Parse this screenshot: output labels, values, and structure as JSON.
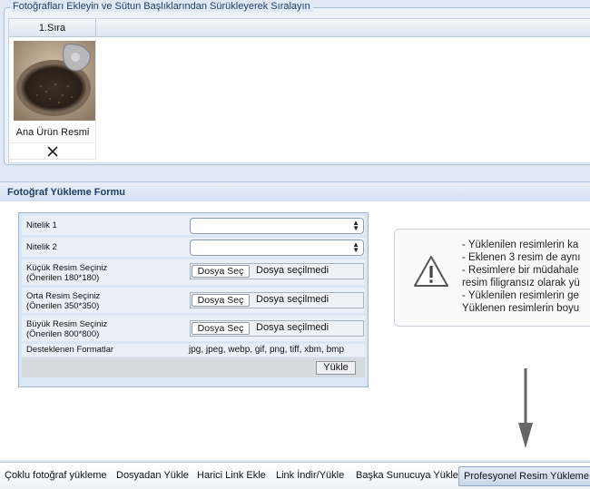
{
  "photos": {
    "legend": "Fotoğrafları Ekleyin ve Sütun Başlıklarından Sürükleyerek Sıralayın",
    "column_header": "1.Sıra",
    "items": [
      {
        "caption": "Ana Ürün Resmi"
      }
    ]
  },
  "form": {
    "title": "Fotoğraf Yükleme Formu",
    "rows": [
      {
        "label": "Nitelik 1"
      },
      {
        "label": "Nitelik 2"
      },
      {
        "label": "Küçük Resim Seçiniz",
        "sublabel": "(Önerilen 180*180)"
      },
      {
        "label": "Orta Resim Seçiniz",
        "sublabel": "(Önerilen 350*350)"
      },
      {
        "label": "Büyük Resim Seçiniz",
        "sublabel": "(Önerilen 800*800)"
      }
    ],
    "file_button_label": "Dosya Seç",
    "file_status": "Dosya seçilmedi",
    "formats_label": "Desteklenen Formatlar",
    "formats_value": "jpg, jpeg, webp, gif, png, tiff, xbm, bmp",
    "submit_label": "Yükle"
  },
  "info": {
    "lines": [
      "- Yüklenilen resimlerin ka",
      "- Eklenen 3 resim de aynı",
      "- Resimlere bir müdahale",
      "resim filigransız olarak yü",
      "- Yüklenilen resimlerin ge",
      "Yüklenen resimlerin boyu"
    ]
  },
  "tabs": [
    {
      "label": "Çoklu fotoğraf yükleme"
    },
    {
      "label": "Dosyadan Yükle"
    },
    {
      "label": "Harici Link Ekle"
    },
    {
      "label": "Link İndir/Yükle"
    },
    {
      "label": "Başka Sunucuya Yükle"
    },
    {
      "label": "Profesyonel Resim Yükleme"
    }
  ],
  "active_tab": "Profesyonel Resim Yükleme",
  "colors": {
    "section_title": "#1f3f66",
    "panel_bg": "#dfe8f4"
  }
}
